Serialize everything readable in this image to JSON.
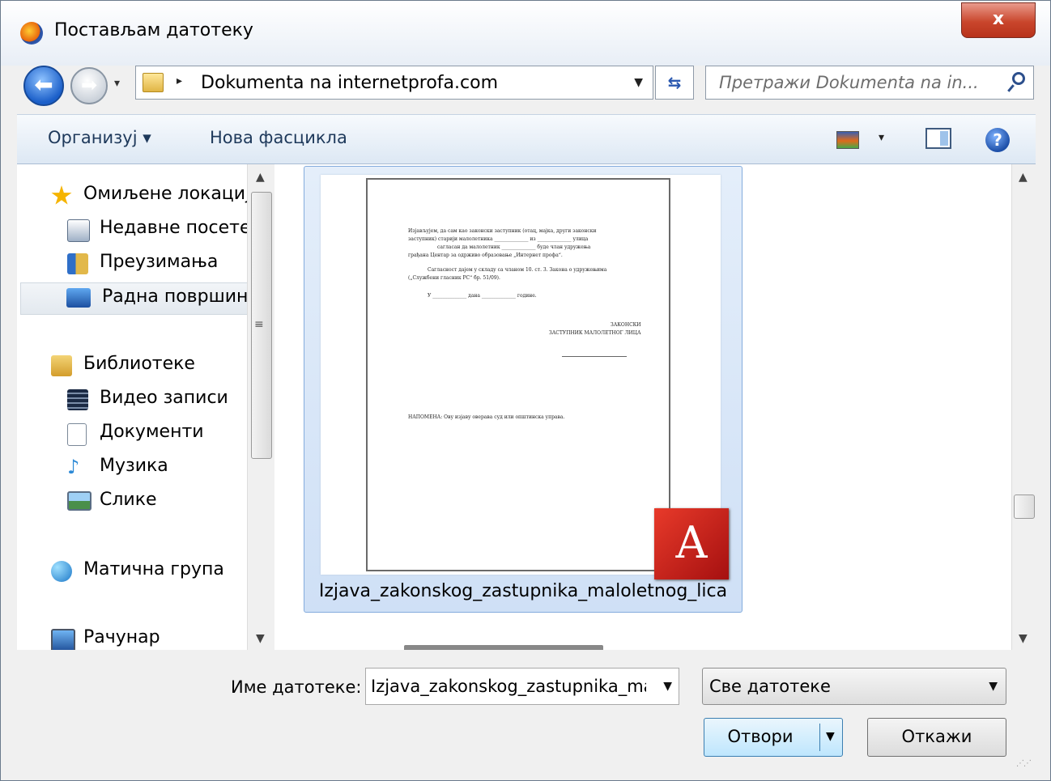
{
  "window": {
    "title": "Постављам датотеку",
    "close_label": "x"
  },
  "navigation": {
    "back_icon": "back-arrow-icon",
    "forward_icon": "forward-arrow-icon",
    "address_separator": "▸",
    "address_path": "Dokumenta na internetprofa.com",
    "search_placeholder": "Претражи Dokumenta na in..."
  },
  "toolbar": {
    "organize_label": "Организуј ▾",
    "new_folder_label": "Нова фасцикла",
    "views_dropdown": "▾",
    "help_label": "?"
  },
  "sidebar": {
    "items": [
      {
        "label": "Омиљене локације",
        "icon": "star-icon",
        "color": "#f5b400"
      },
      {
        "label": "Недавне посете",
        "icon": "recent-places-icon",
        "color": "#7a8ea8"
      },
      {
        "label": "Преузимања",
        "icon": "downloads-folder-icon",
        "color": "#e2b84a"
      },
      {
        "label": "Радна површина",
        "icon": "desktop-icon",
        "color": "#2f73c8"
      },
      {
        "label": "Библиотеке",
        "icon": "libraries-icon",
        "color": "#e2b84a"
      },
      {
        "label": "Видео записи",
        "icon": "videos-icon",
        "color": "#3b4f6e"
      },
      {
        "label": "Документи",
        "icon": "documents-icon",
        "color": "#c9d4e2"
      },
      {
        "label": "Музика",
        "icon": "music-icon",
        "color": "#2d8ad6"
      },
      {
        "label": "Слике",
        "icon": "pictures-icon",
        "color": "#4a8fcf"
      },
      {
        "label": "Матична група",
        "icon": "homegroup-icon",
        "color": "#3aa0e0"
      },
      {
        "label": "Рачунар",
        "icon": "computer-icon",
        "color": "#3a6fb8"
      }
    ]
  },
  "file": {
    "name": "Izjava_zakonskog_zastupnika_maloletnog_lica",
    "type_icon": "pdf-icon",
    "pdf_glyph": "A",
    "preview": {
      "line1": "Изјављујем, да сам као законски заступник (отац, мајка, други законски",
      "line2": "заступник) старији малолетника ______________ из ______________ улица",
      "line3": "сагласан да малолетник ______________ буде члан удружења",
      "line4": "грађана Центар за одрживо образовање „Интернет профа“.",
      "line5": "Сагласност дајем у складу са чланом 10. ст. 3. Закона о удружењима",
      "line6": "(„Службени гласник РС“ бр. 51/09).",
      "line7": "У ______________ дана ______________ године.",
      "sig1": "ЗАКОНСКИ",
      "sig2": "ЗАСТУПНИК МАЛОЛЕТНОГ ЛИЦА",
      "note": "НАПОМЕНА: Ову изјаву оверава суд или општинска управа."
    }
  },
  "footer": {
    "filename_label": "Име датотеке:",
    "filename_value": "Izjava_zakonskog_zastupnika_ma",
    "filter_value": "Све датотеке",
    "open_label": "Отвори",
    "cancel_label": "Откажи",
    "dropdown_glyph": "▼"
  },
  "colors": {
    "accent": "#3c7fb1",
    "selection": "#cfe0f6",
    "close_red": "#c9462c",
    "pdf_red": "#c81f1f"
  }
}
